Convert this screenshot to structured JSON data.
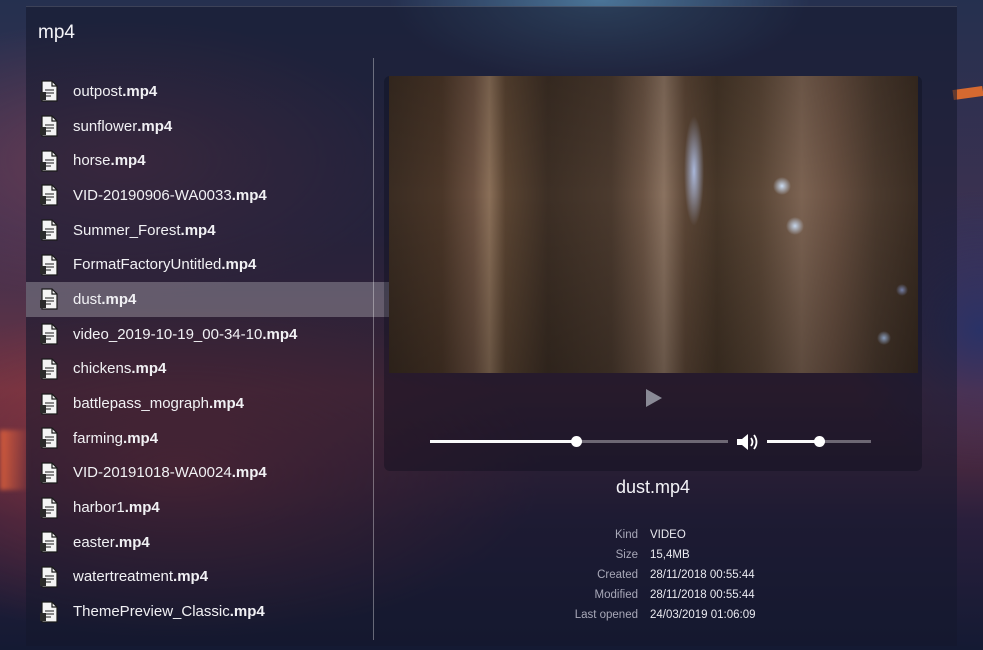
{
  "search": {
    "query": "mp4"
  },
  "files": [
    {
      "stem": "outpost",
      "ext": ".mp4"
    },
    {
      "stem": "sunflower",
      "ext": ".mp4"
    },
    {
      "stem": "horse",
      "ext": ".mp4"
    },
    {
      "stem": "VID-20190906-WA0033",
      "ext": ".mp4"
    },
    {
      "stem": "Summer_Forest",
      "ext": ".mp4"
    },
    {
      "stem": "FormatFactoryUntitled",
      "ext": ".mp4"
    },
    {
      "stem": "dust",
      "ext": ".mp4",
      "selected": true
    },
    {
      "stem": "video_2019-10-19_00-34-10",
      "ext": ".mp4"
    },
    {
      "stem": "chickens",
      "ext": ".mp4"
    },
    {
      "stem": "battlepass_mograph",
      "ext": ".mp4"
    },
    {
      "stem": "farming",
      "ext": ".mp4"
    },
    {
      "stem": "VID-20191018-WA0024",
      "ext": ".mp4"
    },
    {
      "stem": "harbor1",
      "ext": ".mp4"
    },
    {
      "stem": "easter",
      "ext": ".mp4"
    },
    {
      "stem": "watertreatment",
      "ext": ".mp4"
    },
    {
      "stem": "ThemePreview_Classic",
      "ext": ".mp4"
    }
  ],
  "file_icon": "document-icon",
  "preview": {
    "title": "dust.mp4",
    "play_icon": "play-icon",
    "volume_icon": "volume-icon",
    "seek_fraction": 0.49,
    "volume_fraction": 0.5,
    "meta": [
      {
        "key": "Kind",
        "value": "VIDEO"
      },
      {
        "key": "Size",
        "value": "15,4MB"
      },
      {
        "key": "Created",
        "value": "28/11/2018 00:55:44"
      },
      {
        "key": "Modified",
        "value": "28/11/2018 00:55:44"
      },
      {
        "key": "Last opened",
        "value": "24/03/2019 01:06:09"
      }
    ]
  }
}
